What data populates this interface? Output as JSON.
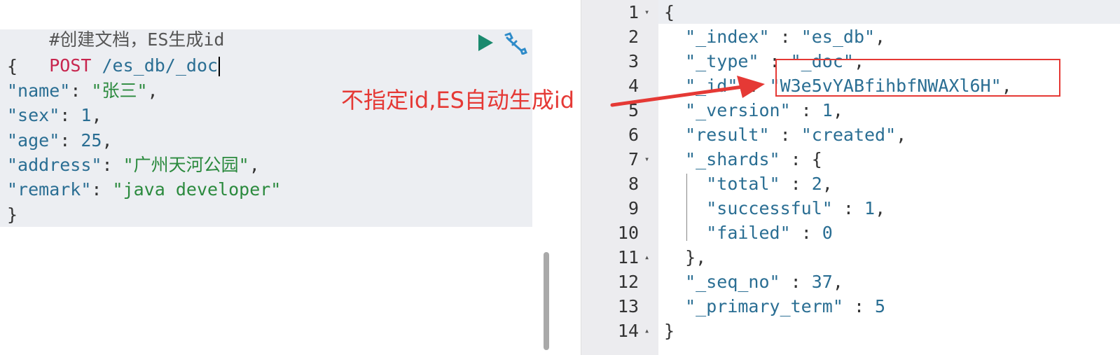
{
  "request": {
    "comment": "#创建文档，ES生成id",
    "method": "POST",
    "path": "/es_db/_doc",
    "run_icon": "play-icon",
    "settings_icon": "wrench-icon",
    "body": {
      "open": "{",
      "name_key": "\"name\"",
      "name_val": "\"张三\"",
      "sex_key": "\"sex\"",
      "sex_val": "1",
      "age_key": "\"age\"",
      "age_val": "25",
      "address_key": "\"address\"",
      "address_val": "\"广州天河公园\"",
      "remark_key": "\"remark\"",
      "remark_val": "\"java developer\"",
      "close": "}"
    }
  },
  "annotation": {
    "text": "不指定id,ES自动生成id",
    "color": "#e53935"
  },
  "response": {
    "line_numbers": [
      "1",
      "2",
      "3",
      "4",
      "5",
      "6",
      "7",
      "8",
      "9",
      "10",
      "11",
      "12",
      "13",
      "14"
    ],
    "lines": {
      "l1": "{",
      "l2_key": "\"_index\"",
      "l2_val": "\"es_db\"",
      "l3_key": "\"_type\"",
      "l3_val": "\"_doc\"",
      "l4_key": "\"_id\"",
      "l4_val": "\"W3e5vYABfihbfNWAXl6H\"",
      "l5_key": "\"_version\"",
      "l5_val": "1",
      "l6_key": "\"result\"",
      "l6_val": "\"created\"",
      "l7_key": "\"_shards\"",
      "l7_val": "{",
      "l8_key": "\"total\"",
      "l8_val": "2",
      "l9_key": "\"successful\"",
      "l9_val": "1",
      "l10_key": "\"failed\"",
      "l10_val": "0",
      "l11": "},",
      "l12_key": "\"_seq_no\"",
      "l12_val": "37",
      "l13_key": "\"_primary_term\"",
      "l13_val": "5",
      "l14": "}"
    }
  }
}
